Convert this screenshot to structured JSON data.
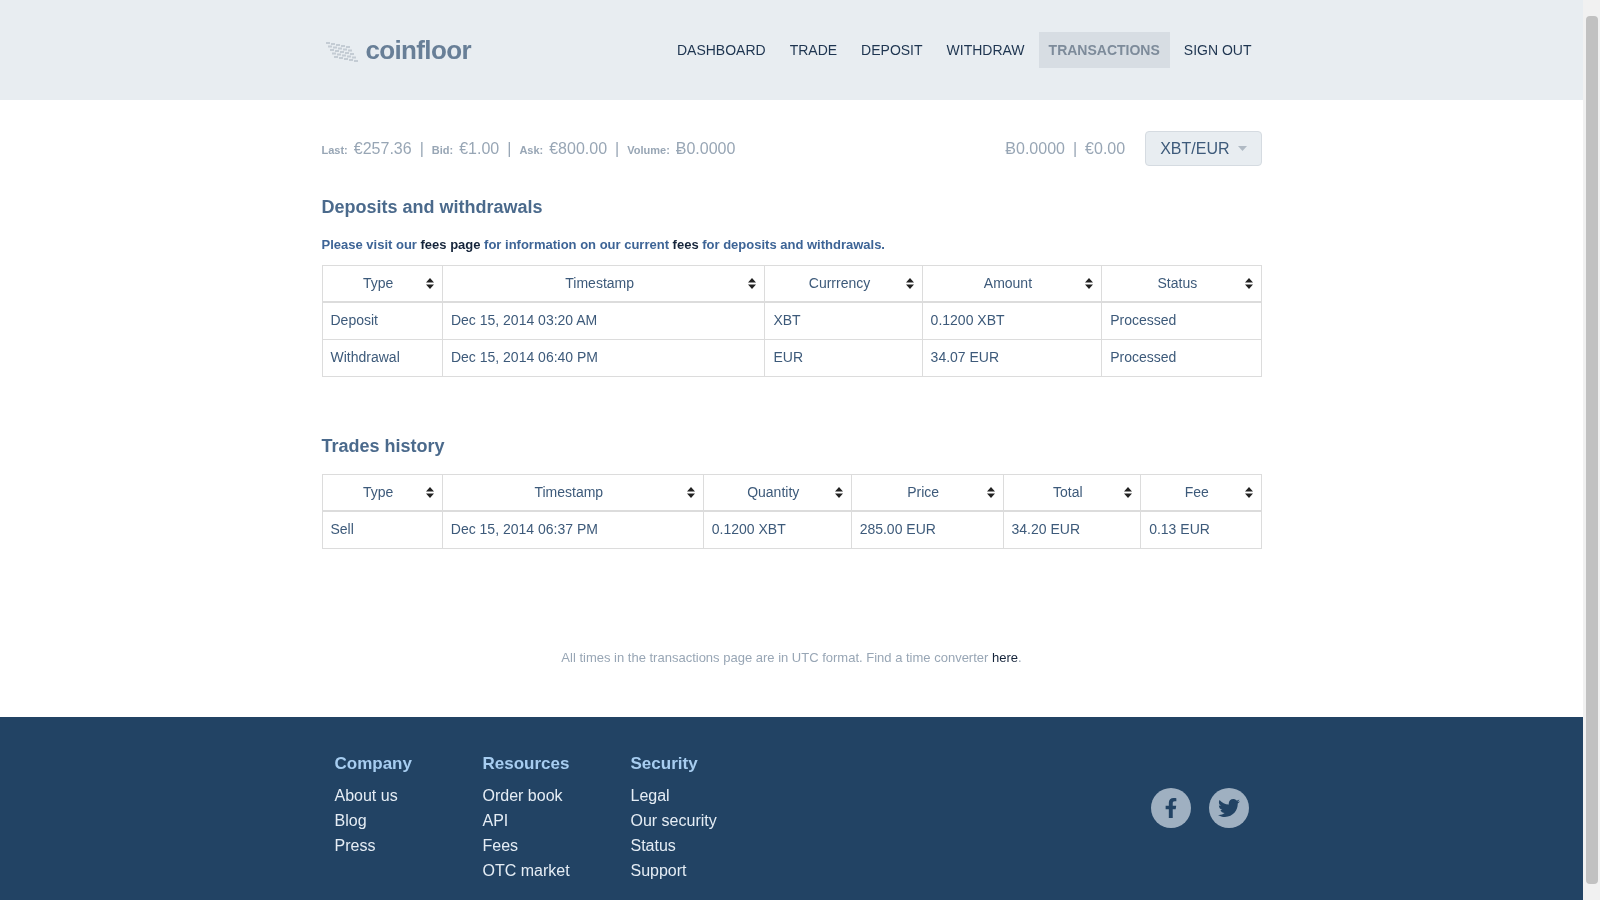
{
  "header": {
    "logo": "coinfloor",
    "nav": [
      {
        "label": "DASHBOARD",
        "selected": false
      },
      {
        "label": "TRADE",
        "selected": false
      },
      {
        "label": "DEPOSIT",
        "selected": false
      },
      {
        "label": "WITHDRAW",
        "selected": false
      },
      {
        "label": "TRANSACTIONS",
        "selected": true
      },
      {
        "label": "SIGN OUT",
        "selected": false
      }
    ]
  },
  "ticker": [
    {
      "kind": "stat",
      "label": "Last:",
      "value": "€257.36"
    },
    {
      "kind": "sep",
      "text": "|"
    },
    {
      "kind": "stat",
      "label": "Bid:",
      "value": "€1.00"
    },
    {
      "kind": "sep",
      "text": "|"
    },
    {
      "kind": "stat",
      "label": "Ask:",
      "value": "€800.00"
    },
    {
      "kind": "sep",
      "text": "|"
    },
    {
      "kind": "stat",
      "label": "Volume:",
      "value": "Ƀ0.0000"
    }
  ],
  "balance": {
    "xbt": "Ƀ0.0000",
    "separator": "|",
    "eur": "€0.00"
  },
  "market_select": {
    "value": "XBT/EUR"
  },
  "deposits": {
    "title": "Deposits and withdrawals",
    "notice": [
      {
        "text": "Please visit our ",
        "link": false
      },
      {
        "text": "fees page",
        "link": true
      },
      {
        "text": " for information on our current ",
        "link": false
      },
      {
        "text": "fees",
        "link": true
      },
      {
        "text": " for deposits and withdrawals.",
        "link": false
      }
    ],
    "columns": [
      "Type",
      "Timestamp",
      "Currrency",
      "Amount",
      "Status"
    ],
    "rows": [
      [
        "Deposit",
        "Dec 15, 2014 03:20 AM",
        "XBT",
        "0.1200 XBT",
        "Processed"
      ],
      [
        "Withdrawal",
        "Dec 15, 2014 06:40 PM",
        "EUR",
        "34.07 EUR",
        "Processed"
      ]
    ]
  },
  "trades": {
    "title": "Trades history",
    "columns": [
      "Type",
      "Timestamp",
      "Quantity",
      "Price",
      "Total",
      "Fee"
    ],
    "rows": [
      [
        "Sell",
        "Dec 15, 2014 06:37 PM",
        "0.1200 XBT",
        "285.00 EUR",
        "34.20 EUR",
        "0.13 EUR"
      ]
    ]
  },
  "utc_note": {
    "text": "All times in the transactions page are in UTC format. Find a time converter ",
    "link": "here",
    "end": "."
  },
  "footer": {
    "columns": [
      {
        "title": "Company",
        "links": [
          "About us",
          "Blog",
          "Press"
        ]
      },
      {
        "title": "Resources",
        "links": [
          "Order book",
          "API",
          "Fees",
          "OTC market"
        ]
      },
      {
        "title": "Security",
        "links": [
          "Legal",
          "Our security",
          "Status",
          "Support"
        ]
      }
    ],
    "social": [
      {
        "kind": "facebook"
      },
      {
        "kind": "twitter"
      }
    ]
  }
}
